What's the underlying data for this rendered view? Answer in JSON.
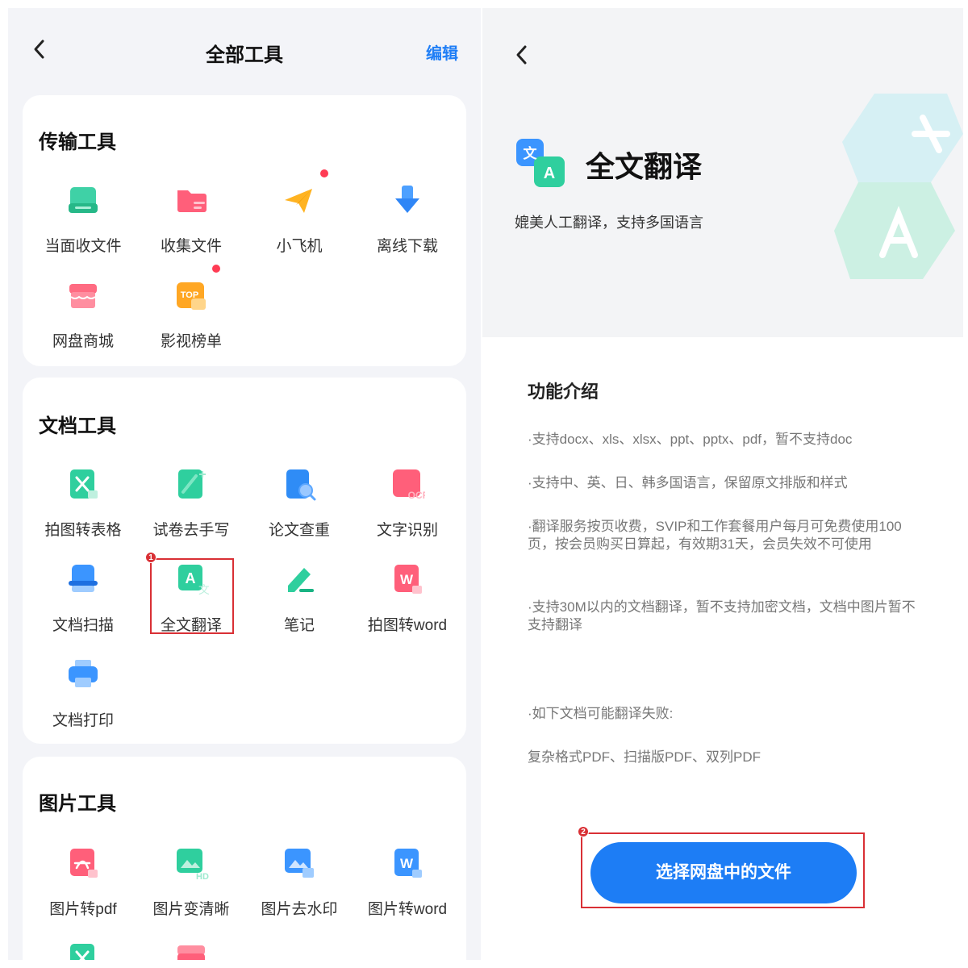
{
  "left_panel": {
    "header": {
      "title": "全部工具",
      "edit_label": "编辑"
    },
    "sections": {
      "transfer": {
        "title": "传输工具",
        "tools": [
          {
            "label": "当面收文件",
            "icon": "tray-receive-icon"
          },
          {
            "label": "收集文件",
            "icon": "folder-collect-icon"
          },
          {
            "label": "小飞机",
            "icon": "paper-plane-icon"
          },
          {
            "label": "离线下载",
            "icon": "download-arrow-icon"
          },
          {
            "label": "网盘商城",
            "icon": "store-icon"
          },
          {
            "label": "影视榜单",
            "icon": "top-chart-icon",
            "icon_text": "TOP"
          }
        ]
      },
      "document": {
        "title": "文档工具",
        "tools": [
          {
            "label": "拍图转表格",
            "icon": "photo-to-sheet-icon"
          },
          {
            "label": "试卷去手写",
            "icon": "remove-handwriting-icon"
          },
          {
            "label": "论文查重",
            "icon": "paper-check-icon"
          },
          {
            "label": "文字识别",
            "icon": "ocr-icon",
            "icon_text": "OCR"
          },
          {
            "label": "文档扫描",
            "icon": "doc-scan-icon"
          },
          {
            "label": "全文翻译",
            "icon": "translate-icon",
            "icon_text": "A"
          },
          {
            "label": "笔记",
            "icon": "pen-note-icon"
          },
          {
            "label": "拍图转word",
            "icon": "photo-to-word-icon",
            "icon_text": "W"
          },
          {
            "label": "文档打印",
            "icon": "printer-icon"
          }
        ]
      },
      "image": {
        "title": "图片工具",
        "tools": [
          {
            "label": "图片转pdf",
            "icon": "image-to-pdf-icon"
          },
          {
            "label": "图片变清晰",
            "icon": "image-enhance-icon",
            "icon_text": "HD"
          },
          {
            "label": "图片去水印",
            "icon": "remove-watermark-icon"
          },
          {
            "label": "图片转word",
            "icon": "image-to-word-icon",
            "icon_text": "W"
          }
        ]
      }
    },
    "highlight_badge": "1"
  },
  "right_panel": {
    "hero": {
      "title": "全文翻译",
      "subtitle": "媲美人工翻译，支持多国语言",
      "logo_glyph_zh": "文",
      "logo_glyph_en": "A"
    },
    "intro_title": "功能介绍",
    "features": [
      "·支持docx、xls、xlsx、ppt、pptx、pdf，暂不支持doc",
      "·支持中、英、日、韩多国语言，保留原文排版和样式",
      "·翻译服务按页收费，SVIP和工作套餐用户每月可免费使用100页，按会员购买日算起，有效期31天，会员失效不可使用",
      "·支持30M以内的文档翻译，暂不支持加密文档，文档中图片暂不支持翻译",
      "·如下文档可能翻译失败:",
      "复杂格式PDF、扫描版PDF、双列PDF"
    ],
    "cta_label": "选择网盘中的文件",
    "highlight_badge": "2"
  },
  "colors": {
    "accent": "#1d7df5",
    "highlight": "#d93035",
    "notification_dot": "#ff3b54",
    "background": "#f3f4f8"
  }
}
